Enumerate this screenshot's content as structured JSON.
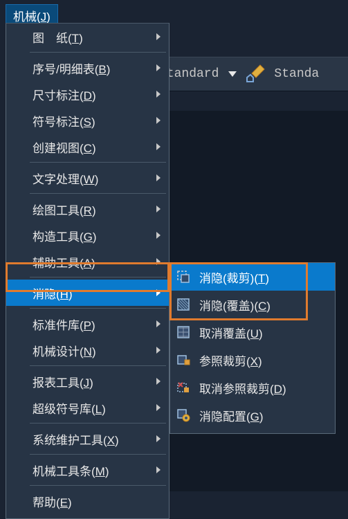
{
  "menu_button": {
    "label": "机械",
    "hotkey": "J"
  },
  "toolbar": {
    "style1": "Standard",
    "style2": "Standa"
  },
  "main_menu": [
    {
      "label": "图　纸",
      "hotkey": "T",
      "sub": true,
      "sep_after": true
    },
    {
      "label": "序号/明细表",
      "hotkey": "B",
      "sub": true
    },
    {
      "label": "尺寸标注",
      "hotkey": "D",
      "sub": true
    },
    {
      "label": "符号标注",
      "hotkey": "S",
      "sub": true
    },
    {
      "label": "创建视图",
      "hotkey": "C",
      "sub": true,
      "sep_after": true
    },
    {
      "label": "文字处理",
      "hotkey": "W",
      "sub": true,
      "sep_after": true
    },
    {
      "label": "绘图工具",
      "hotkey": "R",
      "sub": true
    },
    {
      "label": "构造工具",
      "hotkey": "G",
      "sub": true
    },
    {
      "label": "辅助工具",
      "hotkey": "A",
      "sub": true,
      "sep_after": true
    },
    {
      "label": "消隐",
      "hotkey": "H",
      "sub": true,
      "highlighted": true,
      "sep_after": true
    },
    {
      "label": "标准件库",
      "hotkey": "P",
      "sub": true
    },
    {
      "label": "机械设计",
      "hotkey": "N",
      "sub": true,
      "sep_after": true
    },
    {
      "label": "报表工具",
      "hotkey": "J",
      "sub": true
    },
    {
      "label": "超级符号库",
      "hotkey": "L",
      "sub": true,
      "sep_after": true
    },
    {
      "label": "系统维护工具",
      "hotkey": "X",
      "sub": true,
      "sep_after": true
    },
    {
      "label": "机械工具条",
      "hotkey": "M",
      "sub": true,
      "sep_after": true
    },
    {
      "label": "帮助",
      "hotkey": "E",
      "sub": false
    }
  ],
  "submenu": [
    {
      "icon": "hide-clip-icon",
      "label": "消隐(裁剪)",
      "hotkey": "T",
      "highlighted": true
    },
    {
      "icon": "hide-cover-icon",
      "label": "消隐(覆盖)",
      "hotkey": "C"
    },
    {
      "icon": "uncover-icon",
      "label": "取消覆盖",
      "hotkey": "U"
    },
    {
      "icon": "ref-clip-icon",
      "label": "参照裁剪",
      "hotkey": "X"
    },
    {
      "icon": "cancel-ref-clip-icon",
      "label": "取消参照裁剪",
      "hotkey": "D"
    },
    {
      "icon": "hide-config-icon",
      "label": "消隐配置",
      "hotkey": "G"
    }
  ]
}
